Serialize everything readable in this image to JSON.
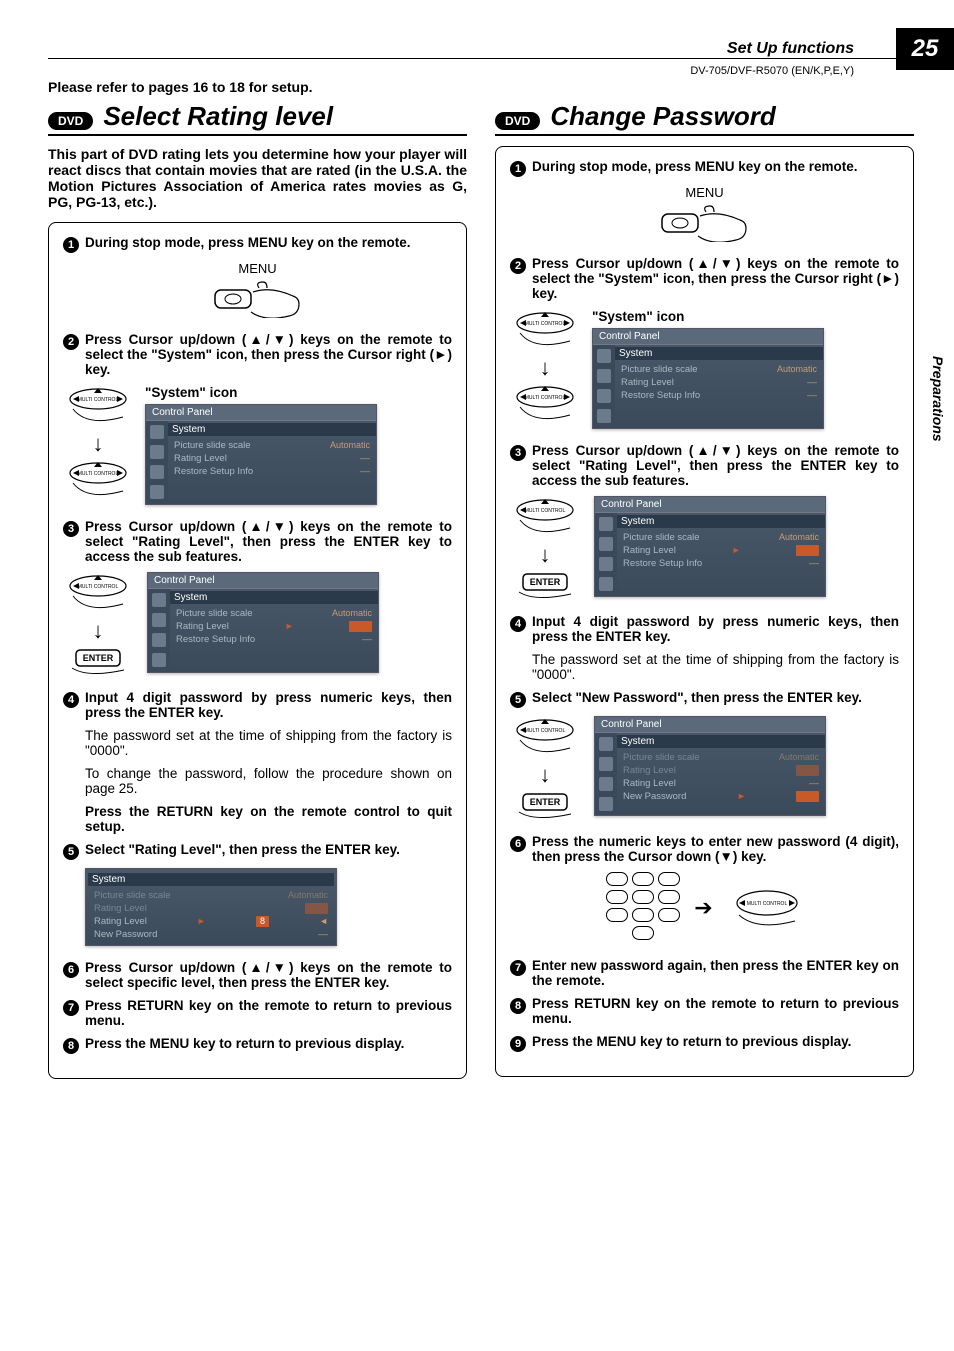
{
  "page_number": "25",
  "header_section": "Set Up functions",
  "model_code": "DV-705/DVF-R5070 (EN/K,P,E,Y)",
  "side_label": "Preparations",
  "intro": "Please refer to pages 16 to 18 for setup.",
  "dvd_badge": "DVD",
  "menu_label": "MENU",
  "enter_label": "ENTER",
  "multicontrol_label": "MULTI CONTROL",
  "system_icon_label": "\"System\" icon",
  "panel": {
    "title": "Control Panel",
    "subhead": "System",
    "r1": "Picture slide scale",
    "r1v": "Automatic",
    "r2": "Rating Level",
    "r3": "Restore Setup Info",
    "new_pw": "New Password"
  },
  "left": {
    "title": "Select Rating level",
    "desc": "This part of DVD rating lets you determine how your player will react discs that contain movies that are rated (in the U.S.A. the Motion Pictures Association of America rates movies as G, PG, PG-13, etc.).",
    "s1": "During stop mode, press MENU key on the remote.",
    "s2": "Press Cursor up/down (▲/▼) keys on the remote to select the \"System\" icon, then press the Cursor right (►) key.",
    "s3": "Press Cursor up/down (▲/▼) keys on the remote to select \"Rating Level\", then press the ENTER key to access the sub features.",
    "s4": "Input 4 digit password by press numeric keys, then press the ENTER key.",
    "s4a": "The password set at the time of shipping from the factory is \"0000\".",
    "s4b": "To change the password, follow the procedure shown on page 25.",
    "s4c": "Press the RETURN key on the remote control to quit setup.",
    "s5": "Select \"Rating Level\", then press the ENTER key.",
    "s6": "Press Cursor up/down (▲/▼) keys on the remote to select specific level, then press the ENTER key.",
    "s7": "Press RETURN key on the remote to return to previous menu.",
    "s8": "Press the MENU key to return to previous display."
  },
  "right": {
    "title": "Change Password",
    "s1": "During stop mode, press MENU key on the remote.",
    "s2": "Press Cursor up/down (▲/▼) keys on the remote to select the \"System\" icon, then press the Cursor right (►) key.",
    "s3": "Press Cursor up/down (▲/▼) keys on the remote to select \"Rating Level\", then press the ENTER key to access the sub features.",
    "s4": "Input 4 digit password by press numeric keys, then press the ENTER key.",
    "s4a": "The password set at the time of shipping from the factory is \"0000\".",
    "s5": "Select \"New Password\", then press the ENTER key.",
    "s6": "Press the numeric keys to enter new password (4 digit), then press the Cursor down (▼) key.",
    "s7": "Enter new password again, then press the ENTER key on the remote.",
    "s8": "Press RETURN key on the remote to return to previous menu.",
    "s9": "Press the MENU key to return to previous display."
  }
}
